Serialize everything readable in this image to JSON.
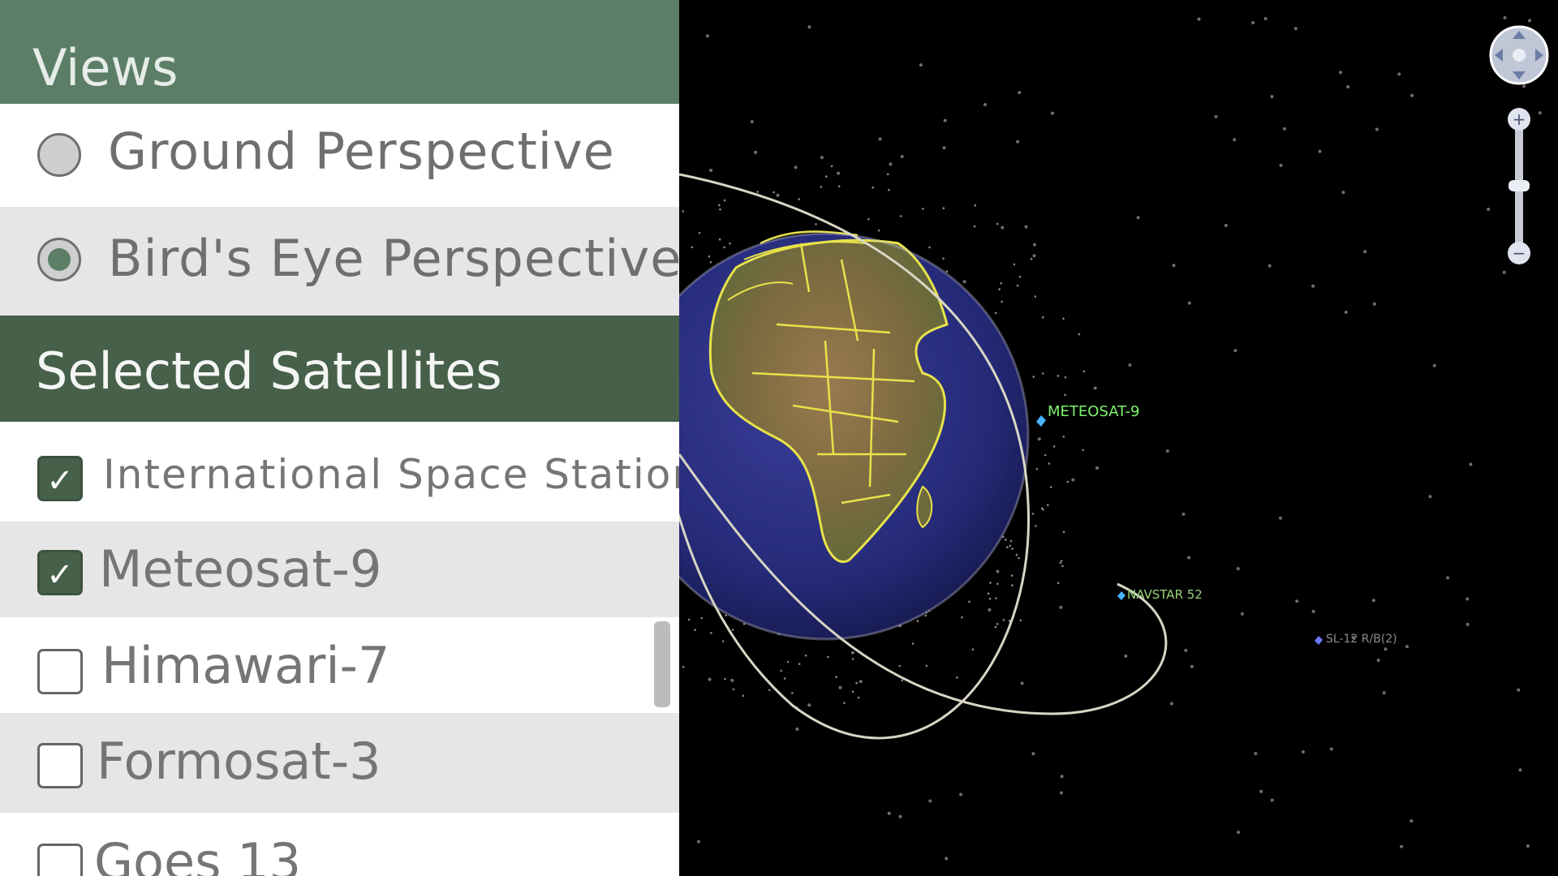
{
  "views": {
    "header": "Views",
    "options": [
      {
        "label": "Ground Perspective",
        "selected": false
      },
      {
        "label": "Bird's Eye Perspective",
        "selected": true
      }
    ]
  },
  "satellites": {
    "header": "Selected Satellites",
    "items": [
      {
        "label": "International Space Station",
        "checked": true
      },
      {
        "label": "Meteosat-9",
        "checked": true
      },
      {
        "label": "Himawari-7",
        "checked": false
      },
      {
        "label": "Formosat-3",
        "checked": false
      },
      {
        "label": "Goes 13",
        "checked": false
      }
    ]
  },
  "map": {
    "satellite_labels": [
      "METEOSAT-9",
      "NAVSTAR 52",
      "SL-12 R/B(2)"
    ]
  },
  "colors": {
    "views_header": "#5c7e67",
    "satellites_header": "#466049",
    "accent": "#5c7e67",
    "meteosat_label": "#7cf56a",
    "orbit": "#d8d6c4"
  },
  "icons": {
    "navigation": "compass-pan-icon",
    "zoom_in": "plus-icon",
    "zoom_out": "minus-icon",
    "check": "check-icon"
  }
}
